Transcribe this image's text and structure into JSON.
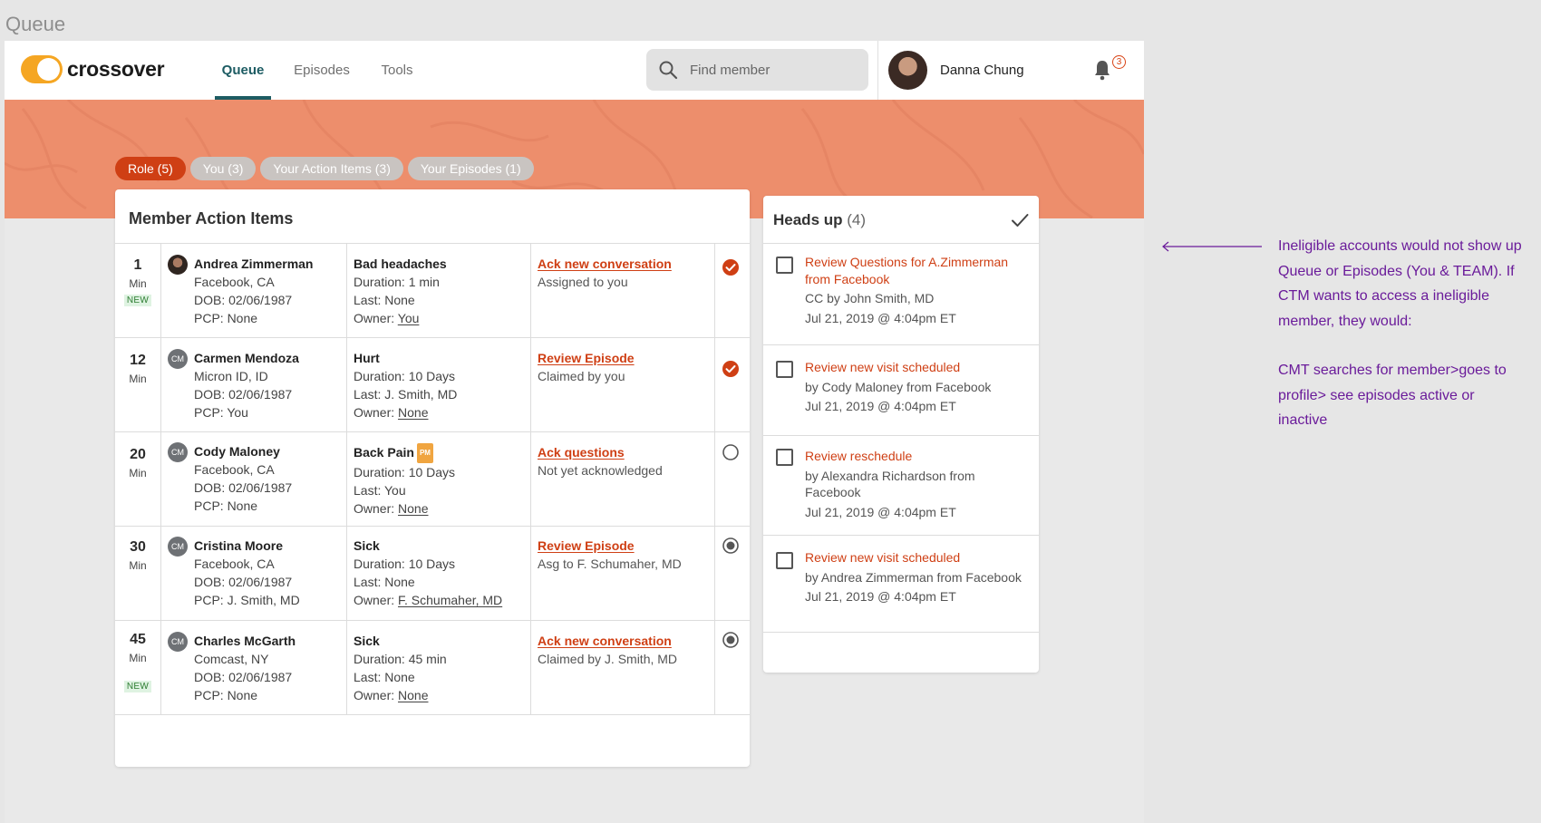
{
  "frame_title": "Queue",
  "nav": {
    "logo_text": "crossover",
    "tabs": [
      {
        "label": "Queue",
        "active": true
      },
      {
        "label": "Episodes",
        "active": false
      },
      {
        "label": "Tools",
        "active": false
      }
    ],
    "search_placeholder": "Find member",
    "user_name": "Danna Chung",
    "notification_count": "3"
  },
  "filters": [
    {
      "label": "Role (5)",
      "active": true
    },
    {
      "label": "You (3)",
      "active": false
    },
    {
      "label": "Your Action Items (3)",
      "active": false
    },
    {
      "label": "Your Episodes (1)",
      "active": false
    }
  ],
  "action_items": {
    "title": "Member Action Items",
    "rows": [
      {
        "minutes": "1",
        "unit": "Min",
        "new": "NEW",
        "avatar": "photo",
        "initials": "",
        "name": "Andrea Zimmerman",
        "location": "Facebook, CA",
        "dob": "DOB: 02/06/1987",
        "pcp": "PCP: None",
        "episode": "Bad headaches",
        "pm": "",
        "duration": "Duration: 1 min",
        "last": "Last: None",
        "owner_prefix": "Owner: ",
        "owner": "You",
        "action": "Ack new conversation",
        "action_sub": "Assigned to you",
        "status": "done"
      },
      {
        "minutes": "12",
        "unit": "Min",
        "new": "",
        "avatar": "initials",
        "initials": "CM",
        "name": "Carmen Mendoza",
        "location": "Micron ID, ID",
        "dob": "DOB: 02/06/1987",
        "pcp": "PCP: You",
        "episode": "Hurt",
        "pm": "",
        "duration": "Duration: 10 Days",
        "last": "Last: J. Smith, MD",
        "owner_prefix": "Owner: ",
        "owner": "None",
        "action": "Review Episode",
        "action_sub": "Claimed by you",
        "status": "done"
      },
      {
        "minutes": "20",
        "unit": "Min",
        "new": "",
        "avatar": "initials",
        "initials": "CM",
        "name": "Cody Maloney",
        "location": "Facebook, CA",
        "dob": "DOB: 02/06/1987",
        "pcp": "PCP: None",
        "episode": "Back Pain",
        "pm": "PM",
        "duration": "Duration: 10 Days",
        "last": "Last: You",
        "owner_prefix": "Owner: ",
        "owner": "None",
        "action": "Ack questions",
        "action_sub": "Not yet acknowledged",
        "status": "empty"
      },
      {
        "minutes": "30",
        "unit": "Min",
        "new": "",
        "avatar": "initials",
        "initials": "CM",
        "name": "Cristina Moore",
        "location": "Facebook, CA",
        "dob": "DOB: 02/06/1987",
        "pcp": "PCP: J. Smith, MD",
        "episode": "Sick",
        "pm": "",
        "duration": "Duration: 10 Days",
        "last": "Last: None",
        "owner_prefix": "Owner: ",
        "owner": "F. Schumaher, MD",
        "action": "Review Episode",
        "action_sub": "Asg to F. Schumaher, MD",
        "status": "claimed"
      },
      {
        "minutes": "45",
        "unit": "Min",
        "new": "NEW",
        "avatar": "initials",
        "initials": "CM",
        "name": "Charles McGarth",
        "location": "Comcast, NY",
        "dob": "DOB: 02/06/1987",
        "pcp": "PCP: None",
        "episode": "Sick",
        "pm": "",
        "duration": "Duration: 45 min",
        "last": "Last: None",
        "owner_prefix": "Owner: ",
        "owner": "None",
        "action": "Ack new conversation",
        "action_sub": "Claimed by J. Smith, MD",
        "status": "claimed"
      }
    ]
  },
  "heads_up": {
    "title": "Heads up",
    "count": "(4)",
    "items": [
      {
        "title": "Review Questions for A.Zimmerman from Facebook",
        "detail": "CC by John Smith, MD",
        "date": "Jul 21, 2019 @ 4:04pm ET"
      },
      {
        "title": "Review new visit scheduled",
        "detail": "by Cody Maloney from Facebook",
        "date": "Jul 21, 2019 @ 4:04pm ET"
      },
      {
        "title": "Review reschedule",
        "detail": "by Alexandra Richardson from Facebook",
        "date": "Jul 21, 2019 @ 4:04pm ET"
      },
      {
        "title": "Review new visit scheduled",
        "detail": "by Andrea Zimmerman from Facebook",
        "date": "Jul 21, 2019 @ 4:04pm ET"
      }
    ]
  },
  "annotation": {
    "paragraph_1": "Ineligible accounts would not show up Queue or Episodes (You & TEAM).  If CTM wants to access a ineligible member, they would:",
    "paragraph_2": "CMT searches for member>goes to profile> see episodes active or inactive"
  },
  "colors": {
    "accent": "#cf3f14",
    "banner": "#ed8e6c",
    "nav_active": "#1d5c63",
    "annotation": "#6a1b9a",
    "logo": "#f5a623"
  }
}
